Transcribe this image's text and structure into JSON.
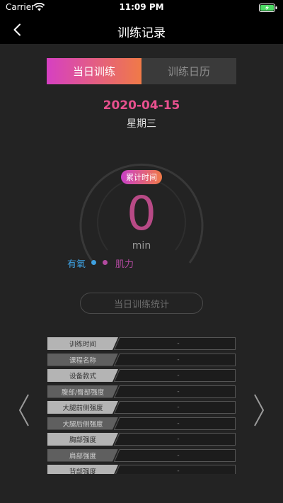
{
  "status_bar": {
    "carrier": "Carrier",
    "time": "11:09 PM"
  },
  "nav": {
    "title": "训练记录"
  },
  "tabs": [
    {
      "label": "当日训练",
      "active": true
    },
    {
      "label": "训练日历",
      "active": false
    }
  ],
  "date": "2020-04-15",
  "weekday": "星期三",
  "summary": {
    "badge": "累计时间",
    "value": "0",
    "unit": "min"
  },
  "legend": {
    "aerobic": "有氧",
    "strength": "肌力"
  },
  "stats_button": "当日训练统计",
  "rows": [
    {
      "label": "训练时间",
      "value": "-"
    },
    {
      "label": "课程名称",
      "value": "-"
    },
    {
      "label": "设备款式",
      "value": "-"
    },
    {
      "label": "腹部/臀部强度",
      "value": "-"
    },
    {
      "label": "大腿前侧强度",
      "value": "-"
    },
    {
      "label": "大腿后侧强度",
      "value": "-"
    },
    {
      "label": "胸部强度",
      "value": "-"
    },
    {
      "label": "肩部强度",
      "value": "-"
    },
    {
      "label": "背部强度",
      "value": "-"
    }
  ],
  "colors": {
    "accent_start": "#d640c2",
    "accent_end": "#f07a47",
    "aerobic": "#3ea0e0",
    "strength": "#b34aa0",
    "battery": "#4cd964"
  }
}
